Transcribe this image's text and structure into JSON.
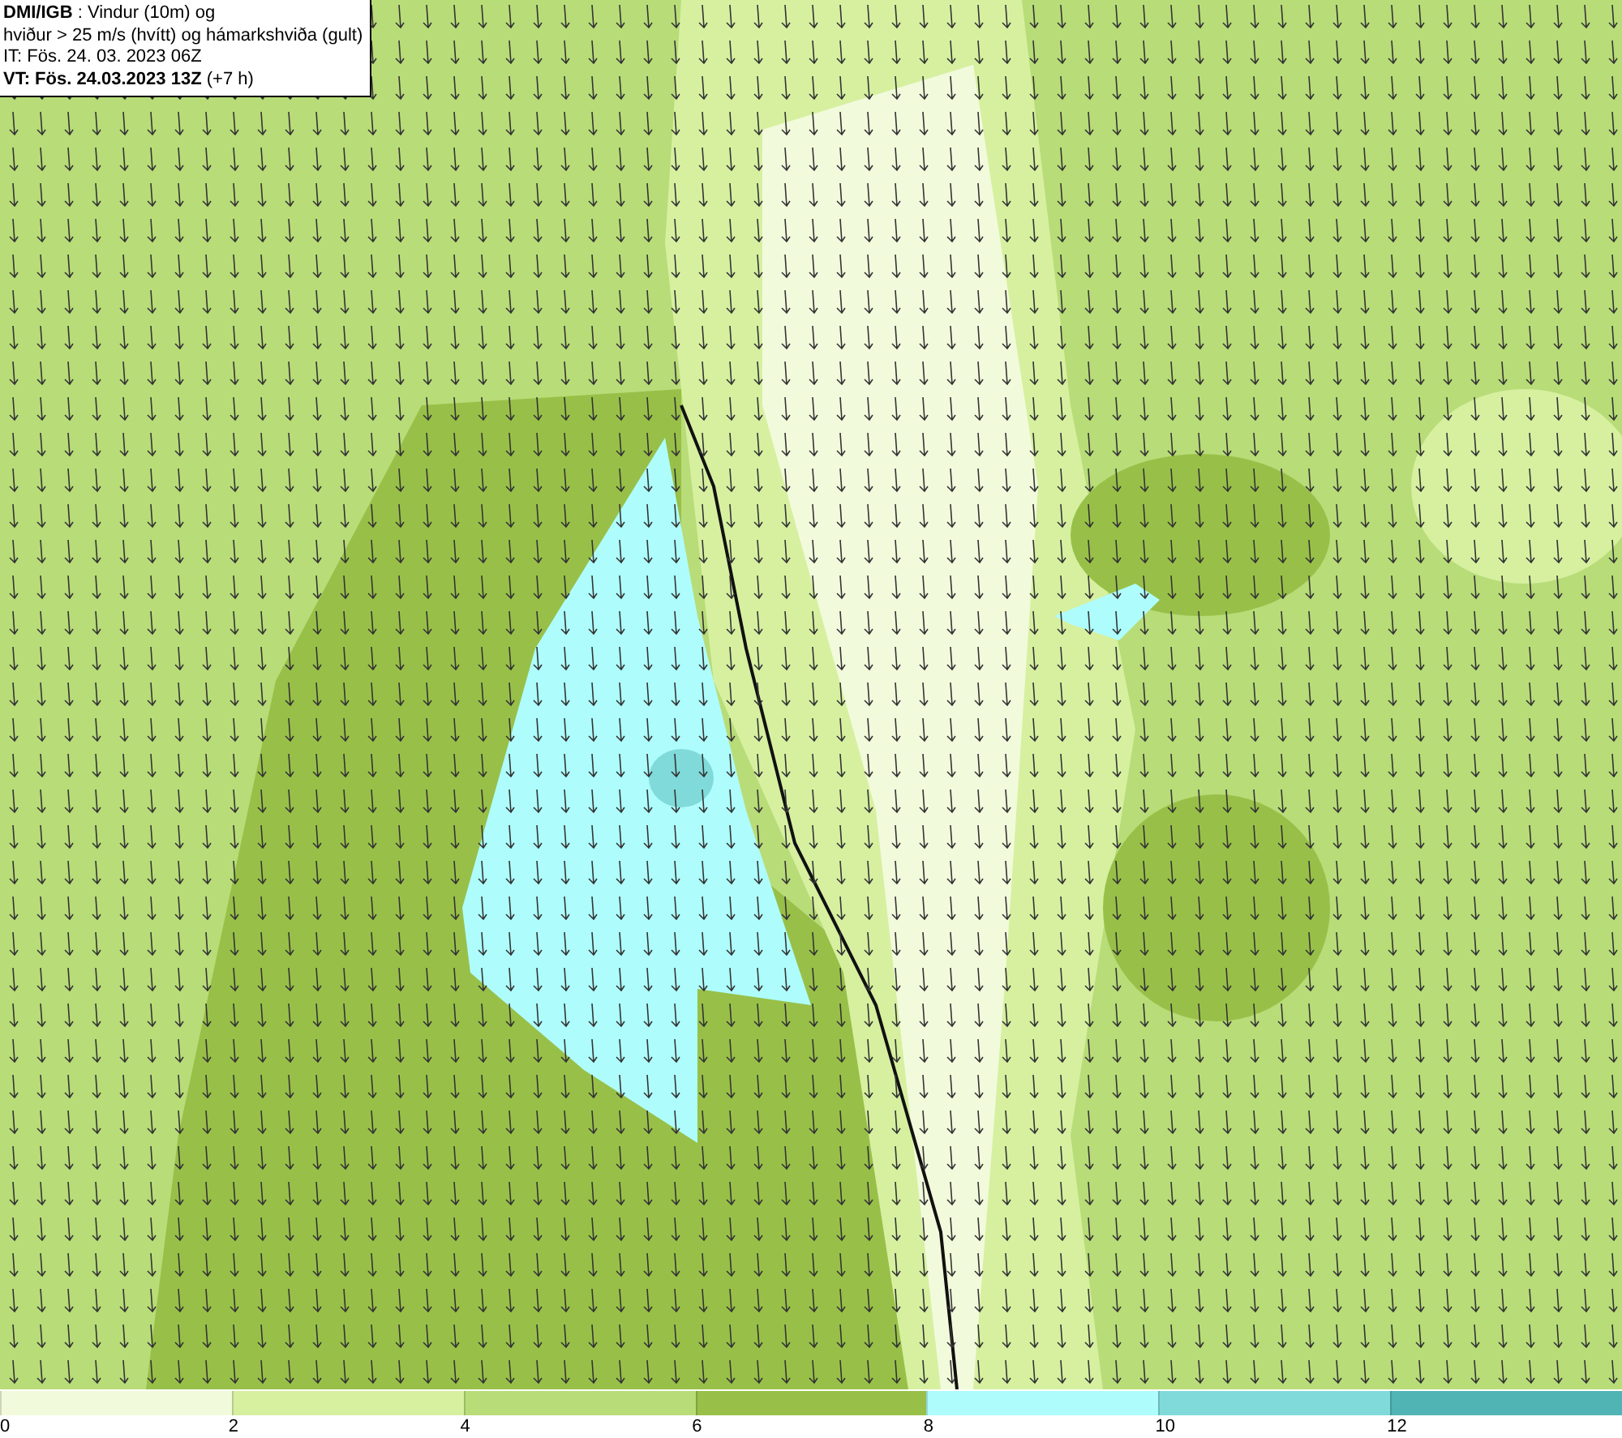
{
  "header": {
    "lines": [
      "**DMI/IGB** : Vindur (10m) og",
      "hviður > 25 m/s (hvítt) og hámarkshviða (gult)",
      "IT: Fös. 24. 03. 2023 06Z",
      "**VT: Fös. 24.03.2023 13Z** (+7 h)"
    ]
  },
  "legend": {
    "segments": [
      {
        "color": "#f2fadc",
        "label": "0"
      },
      {
        "color": "#d6f0a0",
        "label": "2"
      },
      {
        "color": "#b8dc78",
        "label": "4"
      },
      {
        "color": "#98c048",
        "label": "6"
      },
      {
        "color": "#aefcfc",
        "label": "8"
      },
      {
        "color": "#80dada",
        "label": "10"
      },
      {
        "color": "#50b4b4",
        "label": "12"
      }
    ]
  }
}
